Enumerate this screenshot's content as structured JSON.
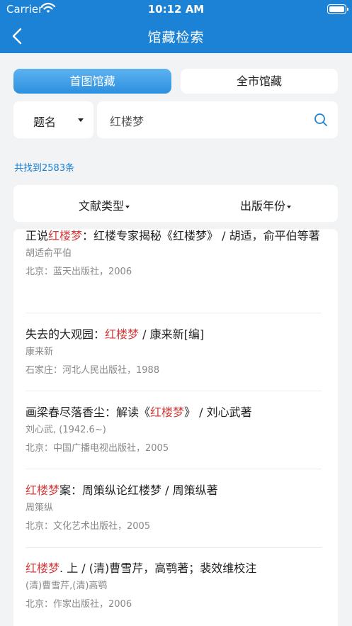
{
  "status_bar": {
    "carrier": "Carrier",
    "time": "10:12 AM"
  },
  "nav": {
    "title": "馆藏检索"
  },
  "tabs": [
    {
      "label": "首图馆藏",
      "active": true
    },
    {
      "label": "全市馆藏",
      "active": false
    }
  ],
  "search": {
    "field_label": "题名",
    "query": "红楼梦"
  },
  "result_count": "共找到2583条",
  "filters": [
    {
      "label": "文献类型"
    },
    {
      "label": "出版年份"
    }
  ],
  "results": [
    {
      "title_pre": "正说",
      "title_hl": "红楼梦",
      "title_post": "：红楼专家揭秘《红楼梦》 / 胡适，俞平伯等著",
      "author": "胡适俞平伯",
      "publisher": "北京：蓝天出版社，2006"
    },
    {
      "title_pre": "失去的大观园：",
      "title_hl": "红楼梦",
      "title_post": " / 康来新[编]",
      "author": "康来新",
      "publisher": "石家庄：河北人民出版社，1988"
    },
    {
      "title_pre": "画梁春尽落香尘：解读《",
      "title_hl": "红楼梦",
      "title_post": "》 / 刘心武著",
      "author": "刘心武, (1942.6~)",
      "publisher": "北京：中国广播电视出版社，2005"
    },
    {
      "title_pre": "",
      "title_hl": "红楼梦",
      "title_post": "案：周策纵论红楼梦 / 周策纵著",
      "author": "周策纵",
      "publisher": "北京：文化艺术出版社，2005"
    },
    {
      "title_pre": "",
      "title_hl": "红楼梦",
      "title_post": ". 上 / (清)曹雪芹，高鹗著；裴效维校注",
      "author": "(清)曹雪芹,(清)高鹗",
      "publisher": "北京：作家出版社，2006"
    }
  ],
  "colors": {
    "header": "#1c82d6",
    "highlight": "#d23b3b",
    "count": "#1c82d6"
  }
}
